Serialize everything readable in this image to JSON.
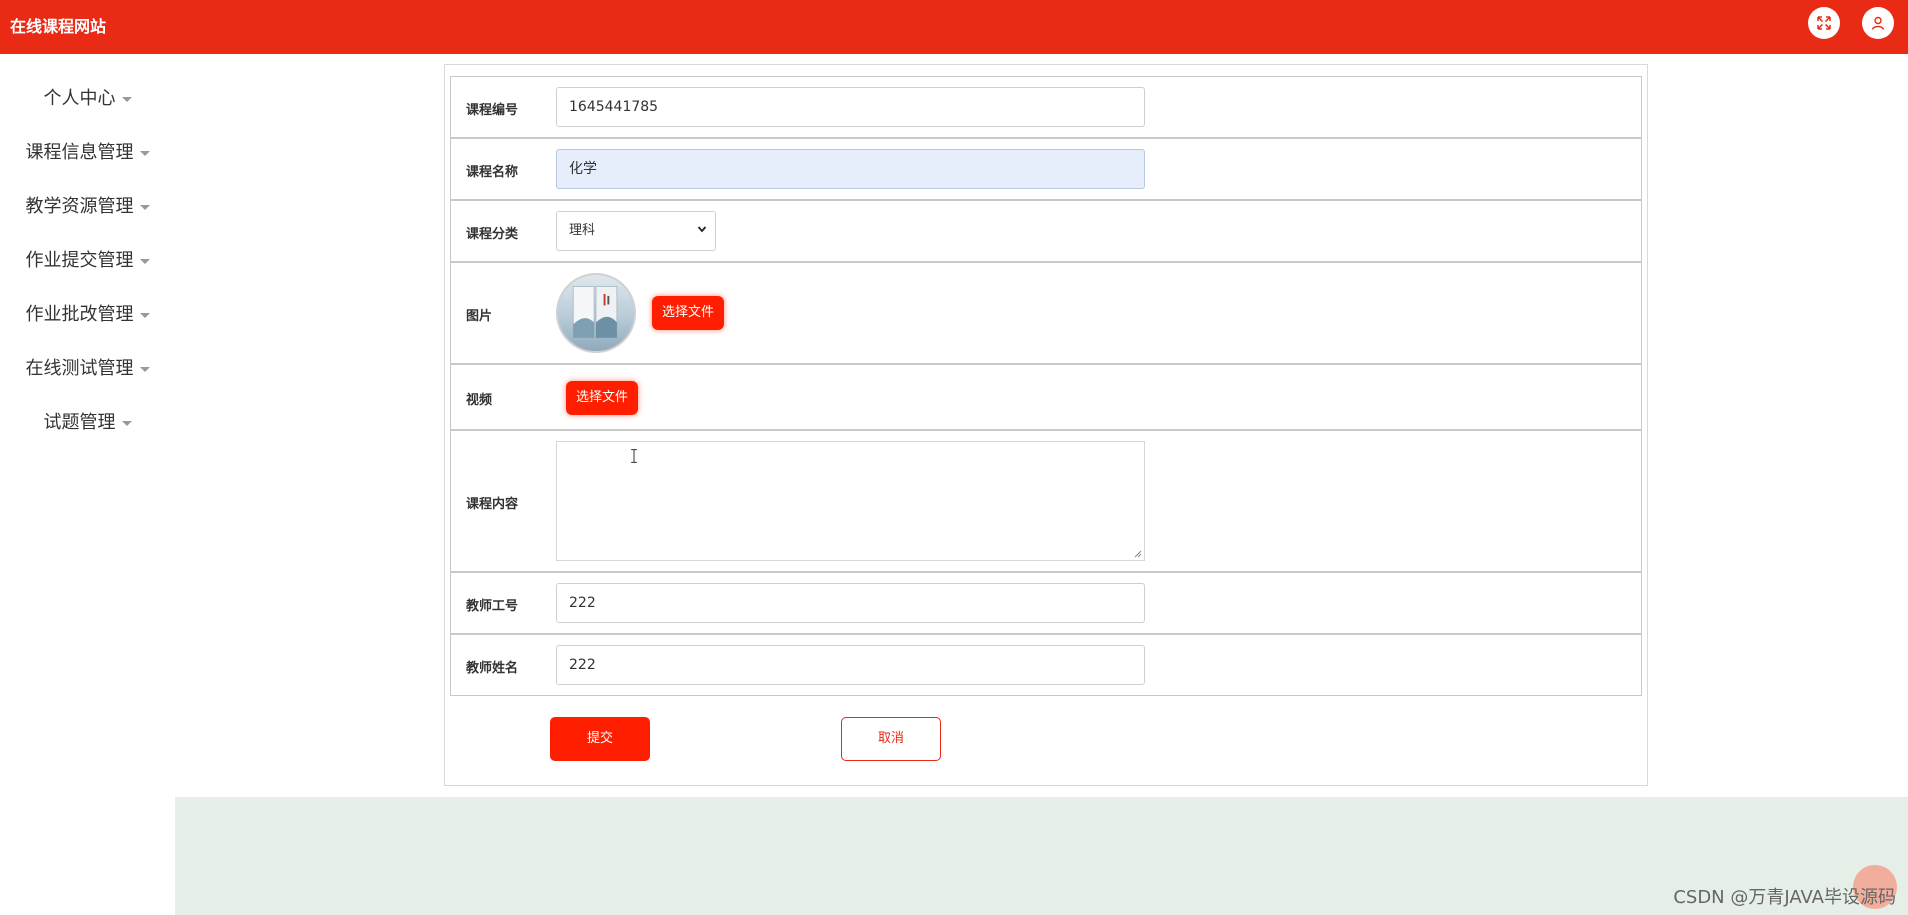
{
  "header": {
    "title": "在线课程网站",
    "icons": [
      "fullscreen-icon",
      "user-icon"
    ],
    "color": "#e92a14"
  },
  "sidebar": {
    "items": [
      {
        "label": "个人中心"
      },
      {
        "label": "课程信息管理"
      },
      {
        "label": "教学资源管理"
      },
      {
        "label": "作业提交管理"
      },
      {
        "label": "作业批改管理"
      },
      {
        "label": "在线测试管理"
      },
      {
        "label": "试题管理"
      }
    ]
  },
  "form": {
    "course_code": {
      "label": "课程编号",
      "value": "1645441785"
    },
    "course_name": {
      "label": "课程名称",
      "value": "化学"
    },
    "course_category": {
      "label": "课程分类",
      "value": "理科"
    },
    "image": {
      "label": "图片",
      "button": "选择文件"
    },
    "video": {
      "label": "视频",
      "button": "选择文件"
    },
    "content": {
      "label": "课程内容",
      "value": ""
    },
    "teacher_id": {
      "label": "教师工号",
      "value": "222"
    },
    "teacher_name": {
      "label": "教师姓名",
      "value": "222"
    },
    "submit_label": "提交",
    "cancel_label": "取消"
  },
  "watermark": "CSDN @万青JAVA毕设源码",
  "colors": {
    "accent": "#ff1f00",
    "footer_band": "#e6eee8",
    "focused_input": "#e5eefa"
  }
}
